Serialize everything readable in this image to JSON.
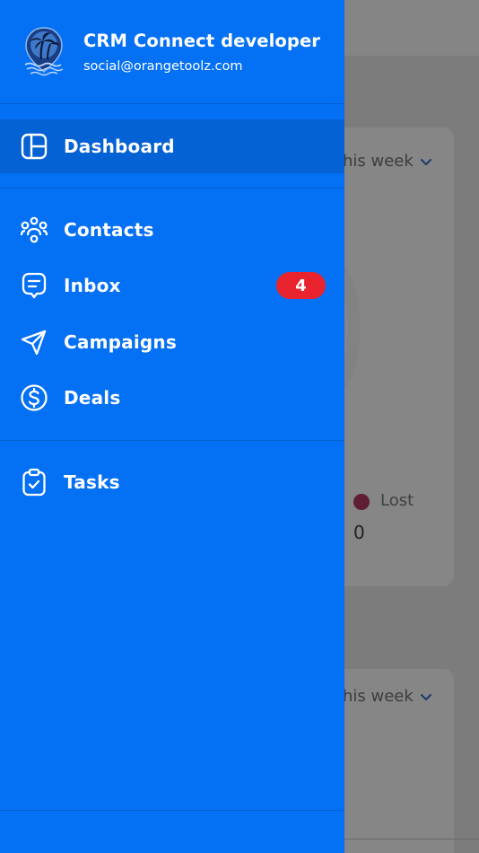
{
  "app": {
    "name": "CRM Connect developer",
    "email": "social@orangetoolz.com",
    "logo_icon": "palm-tree-island-logo"
  },
  "colors": {
    "drawer": "#0470f4",
    "active_item": "#0562d4",
    "badge": "#e8232e",
    "text": "#ffffff"
  },
  "nav": {
    "dashboard": {
      "label": "Dashboard",
      "icon": "dashboard-layout-icon",
      "active": true
    },
    "contacts": {
      "label": "Contacts",
      "icon": "contacts-group-icon"
    },
    "inbox": {
      "label": "Inbox",
      "icon": "chat-bubble-icon",
      "badge": "4"
    },
    "campaigns": {
      "label": "Campaigns",
      "icon": "paper-plane-icon"
    },
    "deals": {
      "label": "Deals",
      "icon": "dollar-circle-icon"
    },
    "tasks": {
      "label": "Tasks",
      "icon": "clipboard-check-icon"
    }
  },
  "background": {
    "card1_filter": "his week",
    "card2_filter": "his week",
    "legend_lost": "Lost",
    "lost_value": "0"
  }
}
